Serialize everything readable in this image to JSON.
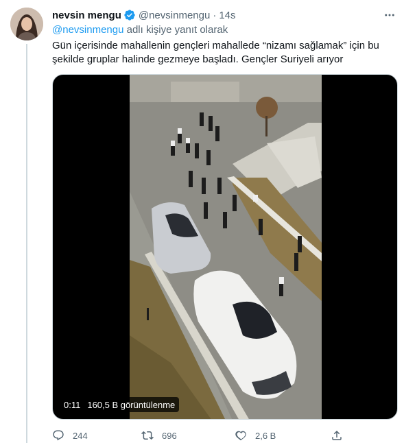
{
  "tweet": {
    "author_name": "nevsin mengu",
    "author_handle": "@nevsinmengu",
    "time": "14s",
    "reply_prefix_mention": "@nevsinmengu",
    "reply_suffix": "adlı kişiye yanıt olarak",
    "text_lines": [
      "Gün içerisinde mahallenin gençleri mahallede “nizamı sağlamak” için bu",
      "şekilde gruplar halinde gezmeye başladı. Gençler Suriyeli arıyor"
    ]
  },
  "media": {
    "duration": "0:11",
    "views": "160,5 B görüntülenme"
  },
  "actions": {
    "reply_count": "244",
    "retweet_count": "696",
    "like_count": "2,6 B"
  },
  "colors": {
    "accent": "#1d9bf0",
    "secondary_text": "#536471",
    "primary_text": "#0f1419"
  },
  "icons": [
    "more-icon",
    "verified-badge-icon",
    "reply-icon",
    "retweet-icon",
    "like-icon",
    "share-icon"
  ]
}
